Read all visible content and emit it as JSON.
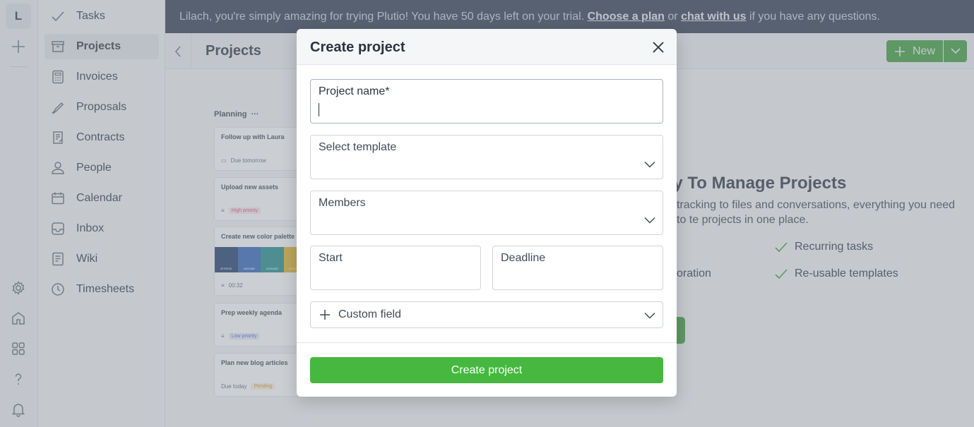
{
  "rail": {
    "avatar_letter": "L",
    "icons": [
      "plus-icon",
      "settings-icon",
      "house-icon",
      "apps-grid-icon",
      "help-icon",
      "bell-icon"
    ]
  },
  "sidebar": {
    "items": [
      {
        "label": "Tasks",
        "icon": "check-icon",
        "active": false
      },
      {
        "label": "Projects",
        "icon": "box-icon",
        "active": true
      },
      {
        "label": "Invoices",
        "icon": "calculator-icon",
        "active": false
      },
      {
        "label": "Proposals",
        "icon": "pen-icon",
        "active": false
      },
      {
        "label": "Contracts",
        "icon": "contract-icon",
        "active": false
      },
      {
        "label": "People",
        "icon": "person-icon",
        "active": false
      },
      {
        "label": "Calendar",
        "icon": "calendar-icon",
        "active": false
      },
      {
        "label": "Inbox",
        "icon": "inbox-icon",
        "active": false
      },
      {
        "label": "Wiki",
        "icon": "document-icon",
        "active": false
      },
      {
        "label": "Timesheets",
        "icon": "clock-icon",
        "active": false
      }
    ]
  },
  "banner": {
    "text_before": "Lilach, you're simply amazing for trying Plutio! You have 50 days left on your trial. ",
    "link_plan": "Choose a plan",
    "text_middle": " or ",
    "link_chat": "chat with us",
    "text_after": " if you have any questions."
  },
  "header": {
    "title": "Projects",
    "new_label": "New"
  },
  "empty_state": {
    "board_title": "Planning",
    "board_dots": "···",
    "cards": [
      {
        "title": "Follow up with Laura",
        "meta": "Due tomorrow"
      },
      {
        "title": "Upload new assets",
        "meta": "High priority"
      },
      {
        "title": "Create new color palette",
        "meta": "00:32",
        "swatches": [
          "#FF8F00",
          "#00008B",
          "#00AA88",
          "#FFCC00"
        ]
      },
      {
        "title": "Prep weekly agenda",
        "meta": "Low priority"
      },
      {
        "title": "Plan new blog articles",
        "meta": "Due today",
        "tag": "Pending"
      }
    ],
    "title": "ay To Manage Projects",
    "description": "tracking to files and conversations, everything you need to te projects in one place.",
    "features": [
      "Recurring tasks",
      "oration",
      "Re-usable templates"
    ]
  },
  "modal": {
    "title": "Create project",
    "fields": {
      "project_name_label": "Project name*",
      "template_label": "Select template",
      "members_label": "Members",
      "start_label": "Start",
      "deadline_label": "Deadline",
      "custom_field_label": "Custom field"
    },
    "submit_label": "Create project"
  },
  "colors": {
    "banner_bg": "#2d3a4f",
    "accent_green": "#46b83f",
    "header_green": "#3a9d3a"
  }
}
